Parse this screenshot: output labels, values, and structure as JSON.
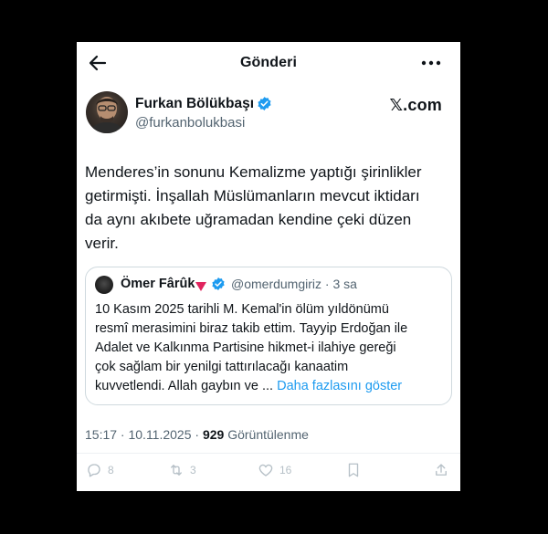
{
  "header": {
    "title": "Gönderi",
    "back_icon": "back-arrow-icon",
    "more_icon": "more-dots-icon"
  },
  "author": {
    "name": "Furkan Bölükbaşı",
    "handle": "@furkanbolukbasi",
    "verified_icon": "verified-badge-icon",
    "verified_color": "#1d9bf0"
  },
  "brand": "𝕏.com",
  "post": {
    "text": "Menderes’in sonunu Kemalizme yaptığı şirinlikler\ngetirmişti. İnşallah Müslümanların mevcut iktidarı\nda aynı akıbete uğramadan kendine çeki düzen\nverir."
  },
  "quote": {
    "name": "Ömer Fârûk",
    "flag_icon": "red-triangle-icon",
    "handle_time": "@omerdumgiriz · 3 sa",
    "text": "10 Kasım 2025 tarihli M. Kemal'in ölüm yıldönümü\nresmî merasimini biraz takib ettim. Tayyip Erdoğan ile\nAdalet ve Kalkınma Partisine hikmet-i ilahiye gereği\nçok sağlam bir yenilgi tattırılacağı kanaatim\nkuvvetlendi. Allah gaybın ve ... ",
    "show_more": "Daha fazlasını göster"
  },
  "meta": {
    "time_date": "15:17 · 10.11.2025 · ",
    "views_count": "929",
    "views_label": " Görüntülenme"
  },
  "actions": [
    {
      "icon": "reply-icon",
      "count": "8"
    },
    {
      "icon": "repost-icon",
      "count": "3"
    },
    {
      "icon": "like-icon",
      "count": "16"
    },
    {
      "icon": "bookmark-icon",
      "count": ""
    },
    {
      "icon": "share-icon",
      "count": ""
    }
  ],
  "colors": {
    "accent": "#1d9bf0",
    "text_primary": "#0f1419",
    "text_secondary": "#536471",
    "flag_red": "#e0245e"
  }
}
